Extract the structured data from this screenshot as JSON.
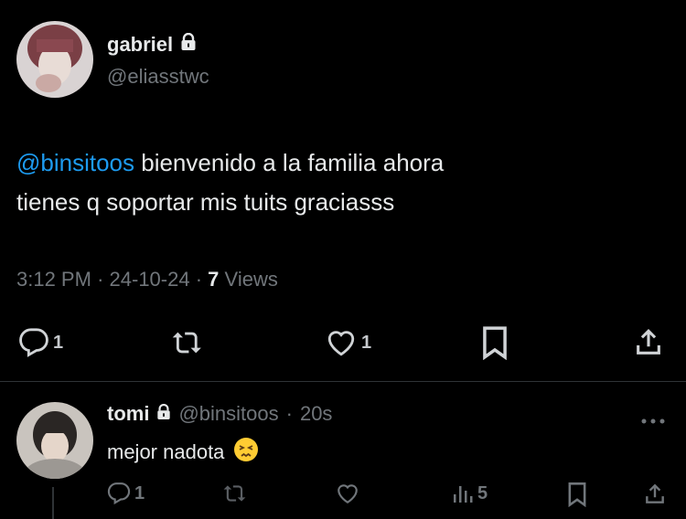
{
  "tweet": {
    "author_name": "gabriel",
    "author_handle": "@eliasstwc",
    "mention": "@binsitoos",
    "text_line1": " bienvenido a la familia ahora",
    "text_line2": "tienes q soportar mis tuits graciasss",
    "time": "3:12 PM",
    "date": "24-10-24",
    "views_count": "7",
    "views_label": "Views",
    "sep": "·",
    "replies": "1",
    "likes": "1"
  },
  "reply": {
    "author_name": "tomi",
    "author_handle": "@binsitoos",
    "time": "20s",
    "sep": "·",
    "text": "mejor nadota",
    "emoji": "😣",
    "replies": "1",
    "views": "5"
  },
  "colors": {
    "accent": "#1d9bf0",
    "muted": "#71767b",
    "text": "#e7e9ea",
    "bg": "#000000"
  }
}
